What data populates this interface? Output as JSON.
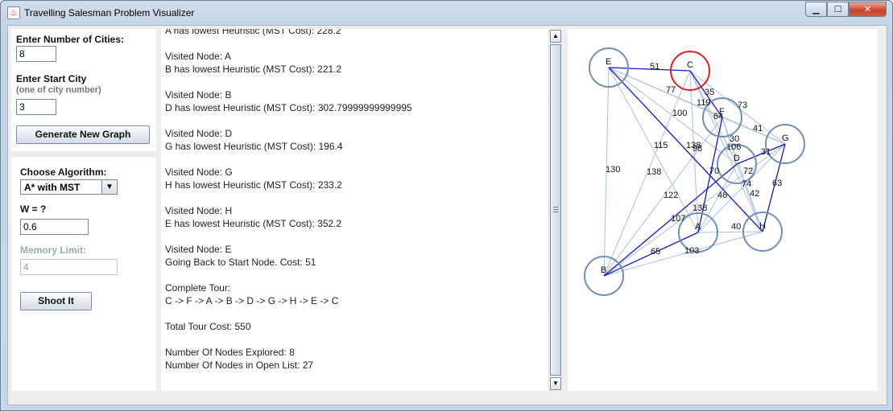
{
  "window": {
    "title": "Travelling Salesman Problem Visualizer",
    "minimize_glyph": "▁",
    "maximize_glyph": "☐",
    "close_glyph": "✕",
    "app_glyph": "♨"
  },
  "setup": {
    "cities_label": "Enter Number of Cities:",
    "cities_value": "8",
    "start_label": "Enter Start City",
    "start_sublabel": "(one of city number)",
    "start_value": "3",
    "generate_button": "Generate New Graph"
  },
  "algorithm": {
    "label": "Choose Algorithm:",
    "selected": "A* with MST",
    "w_label": "W = ?",
    "w_value": "0.6",
    "memory_label": "Memory Limit:",
    "memory_placeholder": "4",
    "run_button": "Shoot It"
  },
  "log": [
    "A has lowest Heuristic (MST Cost): 228.2",
    "",
    "Visited Node: A",
    "B has lowest Heuristic (MST Cost): 221.2",
    "",
    "Visited Node: B",
    "D has lowest Heuristic (MST Cost): 302.79999999999995",
    "",
    "Visited Node: D",
    "G has lowest Heuristic (MST Cost): 196.4",
    "",
    "Visited Node: G",
    "H has lowest Heuristic (MST Cost): 233.2",
    "",
    "Visited Node: H",
    "E has lowest Heuristic (MST Cost): 352.2",
    "",
    "Visited Node: E",
    "Going Back to Start Node. Cost: 51",
    "",
    "Complete Tour:",
    "C -> F -> A -> B -> D -> G -> H -> E -> C",
    "",
    "Total Tour Cost: 550",
    "",
    "Number Of Nodes Explored: 8",
    "Number Of Nodes in Open List: 27"
  ],
  "scrollbar": {
    "up_glyph": "▲",
    "down_glyph": "▼"
  },
  "graph": {
    "colors": {
      "node": "#6e8fb8",
      "start_node": "#e02020",
      "edge": "#a8c0da",
      "tour": "#1a1acc"
    },
    "nodes": [
      {
        "label": "E",
        "start": false
      },
      {
        "label": "C",
        "start": true
      },
      {
        "label": "F",
        "start": false
      },
      {
        "label": "G",
        "start": false
      },
      {
        "label": "D",
        "start": false
      },
      {
        "label": "A",
        "start": false
      },
      {
        "label": "H",
        "start": false
      },
      {
        "label": "B",
        "start": false
      }
    ],
    "edge_labels": [
      "51",
      "77",
      "35",
      "119",
      "73",
      "100",
      "64",
      "41",
      "30",
      "115",
      "138",
      "98",
      "106",
      "31",
      "130",
      "138",
      "70",
      "72",
      "74",
      "63",
      "122",
      "46",
      "42",
      "138",
      "107",
      "40",
      "65",
      "103"
    ]
  }
}
